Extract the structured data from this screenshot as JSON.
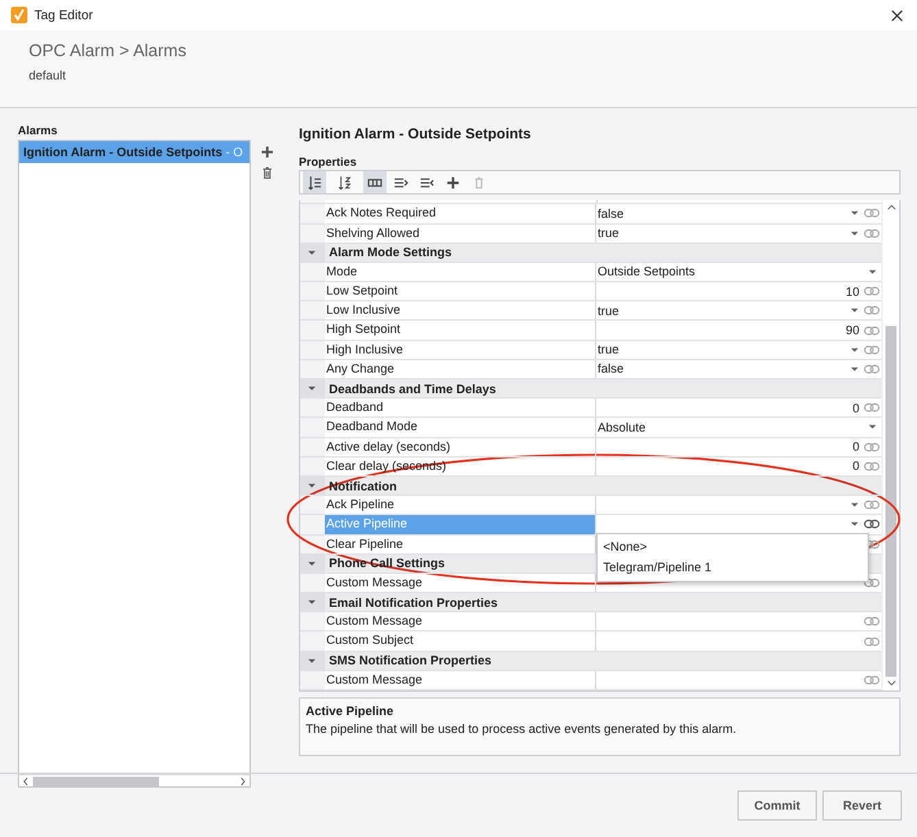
{
  "window": {
    "title": "Tag Editor"
  },
  "header": {
    "breadcrumb": "OPC Alarm > Alarms",
    "subtitle": "default"
  },
  "alarms": {
    "label": "Alarms",
    "items": [
      {
        "name": "Ignition Alarm - Outside Setpoints",
        "suffix": " - O",
        "selected": true
      }
    ]
  },
  "editor": {
    "title": "Ignition Alarm - Outside Setpoints",
    "properties_label": "Properties",
    "toolbar": [
      {
        "kind": "sort-category",
        "selected": true,
        "disabled": false
      },
      {
        "kind": "sort-alpha",
        "selected": false,
        "disabled": false
      },
      {
        "kind": "columns",
        "selected": true,
        "disabled": false
      },
      {
        "kind": "expand",
        "selected": false,
        "disabled": false
      },
      {
        "kind": "collapse",
        "selected": false,
        "disabled": false
      },
      {
        "kind": "add",
        "selected": false,
        "disabled": false
      },
      {
        "kind": "delete",
        "selected": false,
        "disabled": true
      }
    ],
    "rows": [
      {
        "kind": "dropdown",
        "name": "Ack Notes Required",
        "value": "false",
        "bindable": true,
        "selected": false
      },
      {
        "kind": "dropdown",
        "name": "Shelving Allowed",
        "value": "true",
        "bindable": true,
        "selected": false
      },
      {
        "kind": "section",
        "name": "Alarm Mode Settings",
        "expanded": true
      },
      {
        "kind": "dropdown",
        "name": "Mode",
        "value": "Outside Setpoints",
        "bindable": false,
        "selected": false
      },
      {
        "kind": "number",
        "name": "Low Setpoint",
        "value": "10",
        "bindable": true,
        "selected": false
      },
      {
        "kind": "dropdown",
        "name": "Low Inclusive",
        "value": "true",
        "bindable": true,
        "selected": false
      },
      {
        "kind": "number",
        "name": "High Setpoint",
        "value": "90",
        "bindable": true,
        "selected": false
      },
      {
        "kind": "dropdown",
        "name": "High Inclusive",
        "value": "true",
        "bindable": true,
        "selected": false
      },
      {
        "kind": "dropdown",
        "name": "Any Change",
        "value": "false",
        "bindable": true,
        "selected": false
      },
      {
        "kind": "section",
        "name": "Deadbands and Time Delays",
        "expanded": true
      },
      {
        "kind": "number",
        "name": "Deadband",
        "value": "0",
        "bindable": true,
        "selected": false
      },
      {
        "kind": "dropdown",
        "name": "Deadband Mode",
        "value": "Absolute",
        "bindable": false,
        "selected": false
      },
      {
        "kind": "number",
        "name": "Active delay (seconds)",
        "value": "0",
        "bindable": true,
        "selected": false
      },
      {
        "kind": "number",
        "name": "Clear delay (seconds)",
        "value": "0",
        "bindable": true,
        "selected": false
      },
      {
        "kind": "section",
        "name": "Notification",
        "expanded": true
      },
      {
        "kind": "dropdown",
        "name": "Ack Pipeline",
        "bindable": true,
        "selected": false
      },
      {
        "kind": "dropdown",
        "name": "Active Pipeline",
        "bindable": true,
        "selected": true,
        "options": [
          "<None>",
          "Telegram/Pipeline 1"
        ]
      },
      {
        "kind": "text",
        "name": "Clear Pipeline",
        "bindable": true,
        "selected": false
      },
      {
        "kind": "section",
        "name": "Phone Call Settings",
        "expanded": true
      },
      {
        "kind": "text",
        "name": "Custom Message",
        "bindable": true,
        "selected": false
      },
      {
        "kind": "section",
        "name": "Email Notification Properties",
        "expanded": true
      },
      {
        "kind": "text",
        "name": "Custom Message",
        "bindable": true,
        "selected": false
      },
      {
        "kind": "text",
        "name": "Custom Subject",
        "bindable": true,
        "selected": false
      },
      {
        "kind": "section",
        "name": "SMS Notification Properties",
        "expanded": true
      },
      {
        "kind": "text",
        "name": "Custom Message",
        "bindable": true,
        "selected": false
      }
    ],
    "description": {
      "title": "Active Pipeline",
      "text": "The pipeline that will be used to process active events generated by this alarm."
    }
  },
  "buttons": [
    "Commit",
    "Revert"
  ]
}
